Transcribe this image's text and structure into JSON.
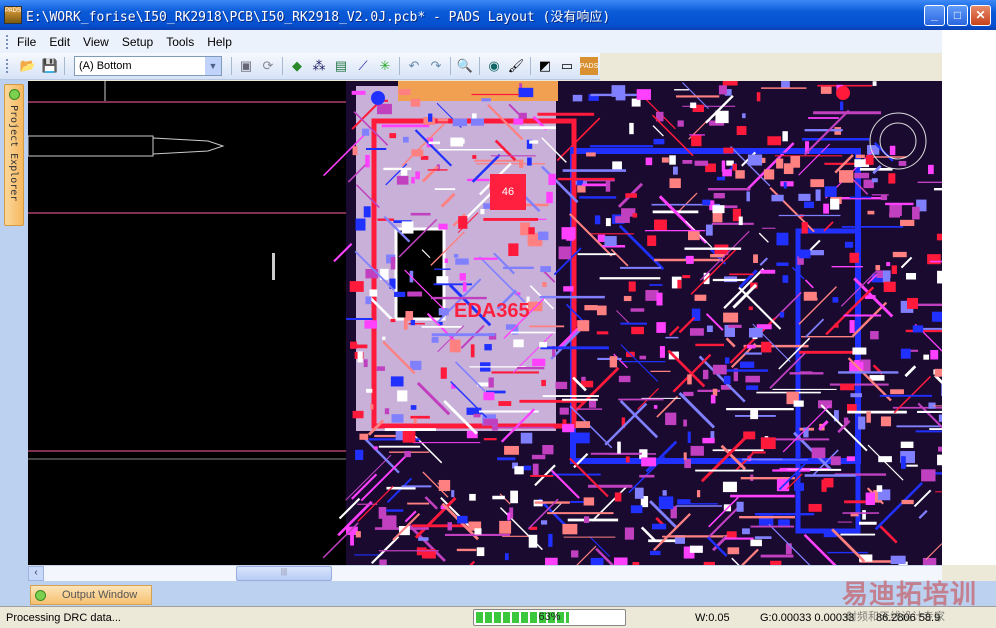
{
  "window": {
    "title": "E:\\WORK_forise\\I50_RK2918\\PCB\\I50_RK2918_V2.0J.pcb* - PADS Layout (没有响应)",
    "app_icon": "PADS",
    "controls": [
      "minimize",
      "maximize",
      "close"
    ]
  },
  "menu": [
    "File",
    "Edit",
    "View",
    "Setup",
    "Tools",
    "Help"
  ],
  "toolbar": {
    "layer": "(A) Bottom",
    "icons": [
      "open-icon",
      "save-icon",
      "properties-icon",
      "redraw-icon",
      "design-toolbar-icon",
      "drafting-icon",
      "dimension-icon",
      "route-icon",
      "ecoicon",
      "undo-icon",
      "redo-icon",
      "zoom-icon",
      "verify-icon",
      "cam-icon",
      "router-icon",
      "layout-icon",
      "pads-icon"
    ]
  },
  "panels": {
    "project_explorer": "Project Explorer",
    "output_window": "Output Window"
  },
  "canvas": {
    "board_label": "EDA365",
    "chip_label": "46"
  },
  "status": {
    "message": "Processing DRC data...",
    "progress_percent": 63,
    "progress_label": "63%",
    "width": "W:0.05",
    "grid": "G:0.00033 0.00033",
    "coords": "86.2806 58.9"
  },
  "watermark": {
    "title": "易迪拓培训",
    "subtitle": "射频和天线设计专家"
  },
  "colors": {
    "accent": "#0a5ad8",
    "pcb_red": "#ff1a3c",
    "pcb_blue": "#2030ff",
    "pcb_magenta": "#ff40ff"
  }
}
